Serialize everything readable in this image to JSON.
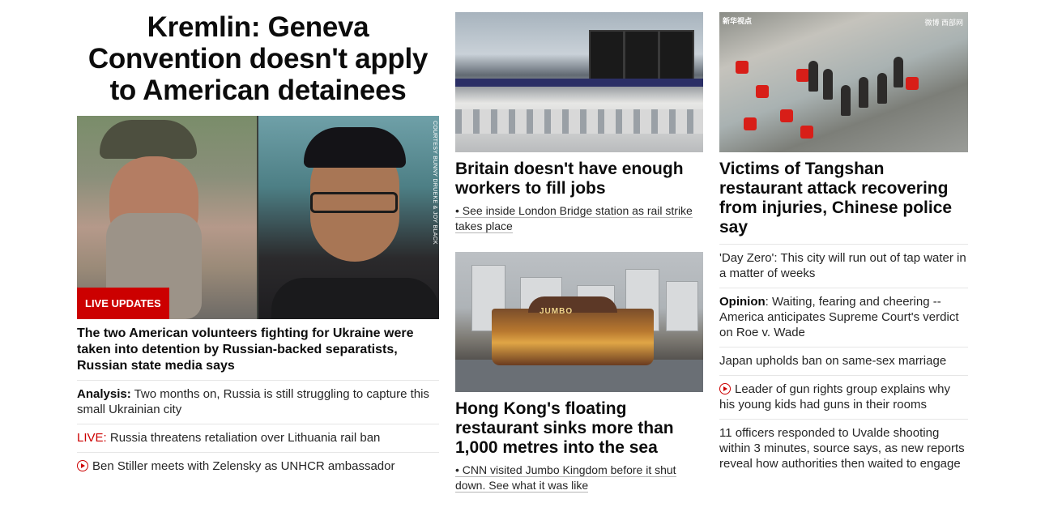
{
  "lead": {
    "headline": "Kremlin: Geneva Convention doesn't apply to American detainees",
    "image_credit": "COURTESY BUNNY DRUEKE & JOY BLACK",
    "badge": "LIVE UPDATES",
    "summary": "The two American volunteers fighting for Ukraine were taken into detention by Russian-backed separatists, Russian state media says",
    "links": [
      {
        "prefix": "Analysis:",
        "text": " Two months on, Russia is still struggling to capture this small Ukrainian city"
      },
      {
        "prefix": "LIVE:",
        "text": " Russia threatens retaliation over Lithuania rail ban"
      },
      {
        "icon": "play-icon",
        "text": "Ben Stiller meets with Zelensky as UNHCR ambassador"
      }
    ]
  },
  "middle": {
    "story1": {
      "title": "Britain doesn't have enough workers to fill jobs",
      "sub": "• See inside London Bridge station as rail strike takes place"
    },
    "story2": {
      "image_sign": "JUMBO",
      "title": "Hong Kong's floating restaurant sinks more than 1,000 metres into the sea",
      "sub": "• CNN visited Jumbo Kingdom before it shut down. See what it was like"
    }
  },
  "right": {
    "image_logo": "新华视点",
    "image_tag": "微博 西部网",
    "title": "Victims of Tangshan restaurant attack recovering from injuries, Chinese police say",
    "links": [
      {
        "text": "'Day Zero': This city will run out of tap water in a matter of weeks"
      },
      {
        "prefix": "Opinion",
        "text": ": Waiting, fearing and cheering -- America anticipates Supreme Court's verdict on Roe v. Wade"
      },
      {
        "text": "Japan upholds ban on same-sex marriage"
      },
      {
        "icon": "play-icon",
        "text": "Leader of gun rights group explains why his young kids had guns in their rooms"
      },
      {
        "text": "11 officers responded to Uvalde shooting within 3 minutes, source says, as new reports reveal how authorities then waited to engage"
      }
    ]
  },
  "colors": {
    "accent_red": "#cc0000",
    "text": "#0c0c0c",
    "divider": "#e6e6e6"
  }
}
